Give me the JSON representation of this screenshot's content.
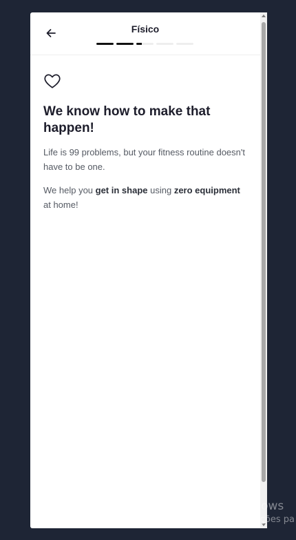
{
  "header": {
    "title": "Físico",
    "progress": {
      "total_steps": 5,
      "completed_steps": 2,
      "current_step_fraction": 0.3
    }
  },
  "content": {
    "heading": "We know how to make that happen!",
    "paragraph1": "Life is 99 problems, but your fitness routine doesn't have to be one.",
    "paragraph2": {
      "part1": "We help you ",
      "bold1": "get in shape",
      "part2": " using ",
      "bold2": "zero equipment",
      "part3": " at home!"
    }
  },
  "watermark": {
    "line1": "Ativar o Windows",
    "line2": "Acesse Configurações pa"
  },
  "colors": {
    "page_background": "#1e2535",
    "card_background": "#ffffff",
    "text_primary": "#1d1d2b",
    "progress_active": "#111111",
    "progress_inactive": "#eeeeee"
  },
  "icons": {
    "back": "arrow-left-icon",
    "heart": "heart-outline-icon"
  }
}
